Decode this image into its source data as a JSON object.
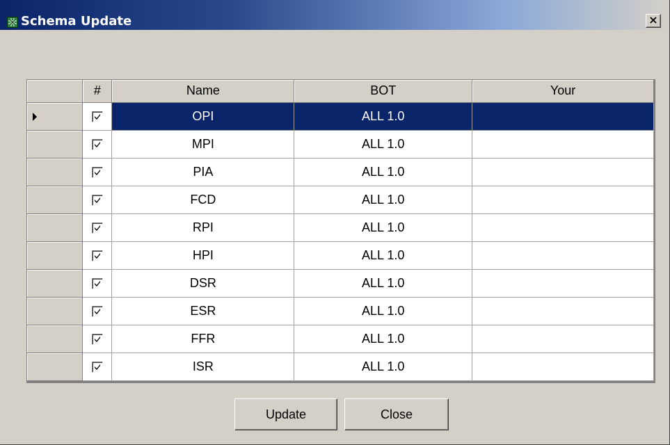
{
  "window": {
    "title": "Schema Update",
    "close_glyph": "×",
    "icon": "schema-app-icon"
  },
  "colors": {
    "title_bar_start": "#0a246a",
    "title_bar_end": "#d4d0c8",
    "selection": "#0a246a",
    "face": "#d4d0c8"
  },
  "grid": {
    "columns": [
      "#",
      "Name",
      "BOT",
      "Your"
    ],
    "selected_row_index": 0,
    "rows": [
      {
        "checked": true,
        "name": "OPI",
        "bot": "ALL 1.0",
        "your": ""
      },
      {
        "checked": true,
        "name": "MPI",
        "bot": "ALL 1.0",
        "your": ""
      },
      {
        "checked": true,
        "name": "PIA",
        "bot": "ALL 1.0",
        "your": ""
      },
      {
        "checked": true,
        "name": "FCD",
        "bot": "ALL 1.0",
        "your": ""
      },
      {
        "checked": true,
        "name": "RPI",
        "bot": "ALL 1.0",
        "your": ""
      },
      {
        "checked": true,
        "name": "HPI",
        "bot": "ALL 1.0",
        "your": ""
      },
      {
        "checked": true,
        "name": "DSR",
        "bot": "ALL 1.0",
        "your": ""
      },
      {
        "checked": true,
        "name": "ESR",
        "bot": "ALL 1.0",
        "your": ""
      },
      {
        "checked": true,
        "name": "FFR",
        "bot": "ALL 1.0",
        "your": ""
      },
      {
        "checked": true,
        "name": "ISR",
        "bot": "ALL 1.0",
        "your": ""
      }
    ]
  },
  "buttons": {
    "update_label": "Update",
    "close_label": "Close"
  }
}
